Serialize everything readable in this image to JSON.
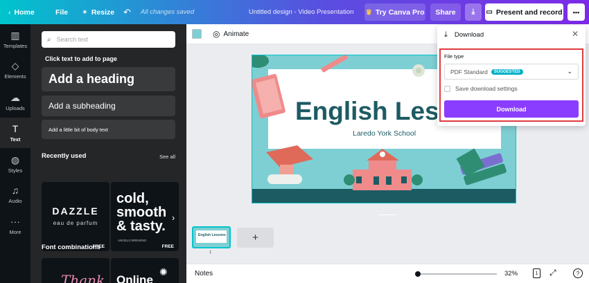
{
  "topbar": {
    "home": "Home",
    "file": "File",
    "resize": "Resize",
    "saved_status": "All changes saved",
    "doc_title": "Untitled design - Video Presentation",
    "try_pro": "Try Canva Pro",
    "share": "Share",
    "present": "Present and record",
    "more": "•••"
  },
  "rail": [
    {
      "label": "Templates",
      "icon": "templates-icon"
    },
    {
      "label": "Elements",
      "icon": "elements-icon"
    },
    {
      "label": "Uploads",
      "icon": "uploads-icon"
    },
    {
      "label": "Text",
      "icon": "text-icon"
    },
    {
      "label": "Styles",
      "icon": "styles-icon"
    },
    {
      "label": "Audio",
      "icon": "audio-icon"
    },
    {
      "label": "More",
      "icon": "more-icon"
    }
  ],
  "panel": {
    "search_placeholder": "Search text",
    "click_text": "Click text to add to page",
    "heading": "Add a heading",
    "subheading": "Add a subheading",
    "body": "Add a little bit of body text",
    "recently_used": "Recently used",
    "see_all": "See all",
    "card1_title": "DAZZLE",
    "card1_sub": "eau de parfum",
    "card1_badge": "FREE",
    "card2_line1": "cold,",
    "card2_line2": "smooth",
    "card2_line3": "& tasty.",
    "card2_small": "ANGELO BREWING",
    "card2_badge": "FREE",
    "font_combinations": "Font combinations",
    "combo1": "Thank",
    "combo2": "Online"
  },
  "context": {
    "animate": "Animate",
    "swatch_color": "#7ecfd3"
  },
  "slide": {
    "title": "English Lessons",
    "subtitle": "Laredo York School"
  },
  "download": {
    "title": "Download",
    "file_type_label": "File type",
    "file_type_value": "PDF Standard",
    "badge": "SUGGESTED",
    "save_settings": "Save download settings",
    "button": "Download"
  },
  "pages": {
    "thumb_title": "English Lessons",
    "page_number": "1",
    "add": "+"
  },
  "bottombar": {
    "notes": "Notes",
    "zoom": "32%",
    "page_count": "1",
    "help": "?",
    "zoom_fraction": 0.32
  },
  "colors": {
    "accent": "#8b3dff",
    "teal": "#00c4cc",
    "highlight": "#e03a3e"
  }
}
